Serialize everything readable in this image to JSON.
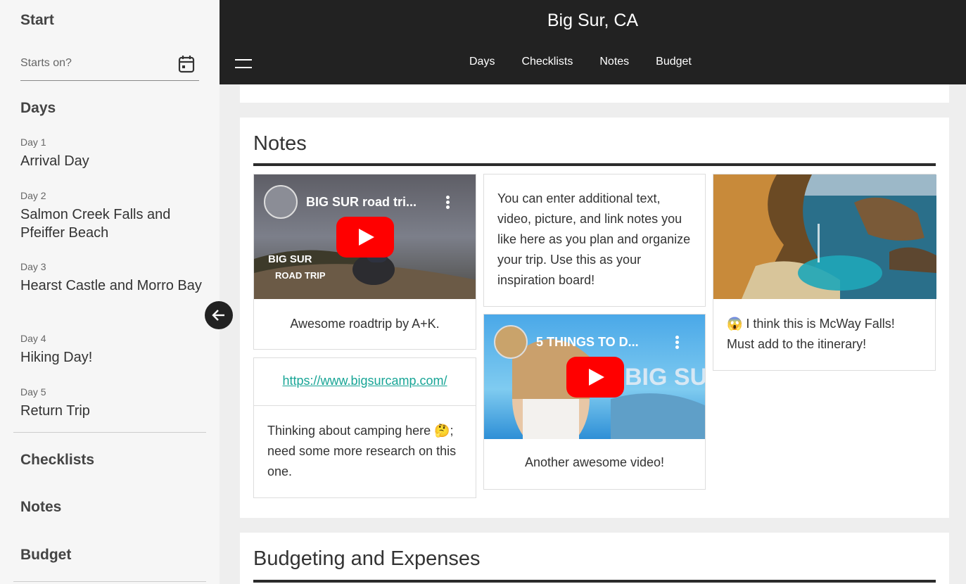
{
  "header": {
    "title": "Big Sur, CA",
    "nav": [
      "Days",
      "Checklists",
      "Notes",
      "Budget"
    ]
  },
  "sidebar": {
    "start_heading": "Start",
    "start_placeholder": "Starts on?",
    "days_heading": "Days",
    "days": [
      {
        "num": "Day 1",
        "title": "Arrival Day"
      },
      {
        "num": "Day 2",
        "title": "Salmon Creek Falls and Pfeiffer Beach"
      },
      {
        "num": "Day 3",
        "title": "Hearst Castle and Morro Bay"
      },
      {
        "num": "Day 4",
        "title": "Hiking Day!"
      },
      {
        "num": "Day 5",
        "title": "Return Trip"
      }
    ],
    "checklists_heading": "Checklists",
    "notes_heading": "Notes",
    "budget_heading": "Budget"
  },
  "notes": {
    "title": "Notes",
    "video1": {
      "title": "BIG SUR road tri...",
      "caption": "Awesome roadtrip by A+K.",
      "thumb_text_1": "BIG SUR",
      "thumb_text_2": "ROAD TRIP"
    },
    "link_note": {
      "url": "https://www.bigsurcamp.com/",
      "text": "Thinking about camping here 🤔; need some more research on this one."
    },
    "text_note": "You can enter additional text, video, picture, and link notes you like here as you plan and organize your trip. Use this as your inspiration board!",
    "video2": {
      "title": "5 THINGS TO D...",
      "caption": "Another awesome video!",
      "thumb_text": "BIG SUR"
    },
    "image_note": {
      "caption": "😱 I think this is McWay Falls! Must add to the itinerary!"
    }
  },
  "budget": {
    "title": "Budgeting and Expenses"
  },
  "colors": {
    "header_bg": "#222222",
    "link": "#18a596",
    "sidebar_bg": "#f6f6f6"
  }
}
